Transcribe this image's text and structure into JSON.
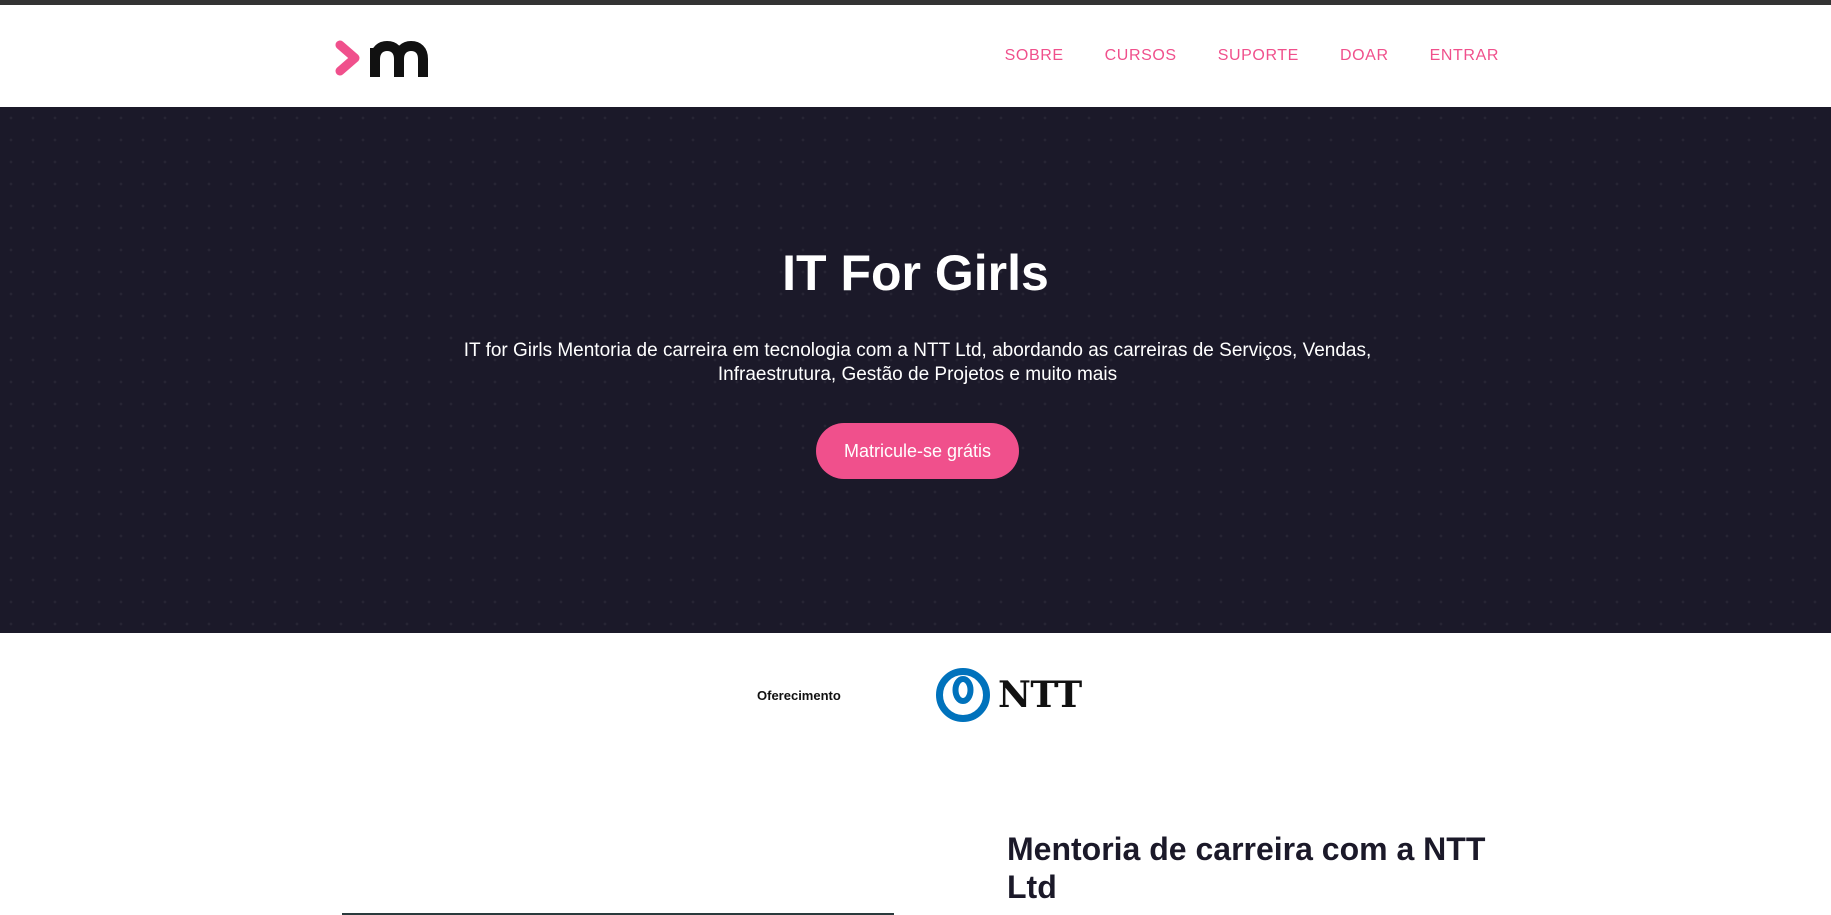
{
  "header": {
    "logo_name": "m-logo",
    "nav": [
      {
        "label": "SOBRE"
      },
      {
        "label": "CURSOS"
      },
      {
        "label": "SUPORTE"
      },
      {
        "label": "DOAR"
      },
      {
        "label": "ENTRAR"
      }
    ]
  },
  "hero": {
    "title": "IT For Girls",
    "subtitle": "IT for Girls Mentoria de carreira em tecnologia com a NTT Ltd, abordando as carreiras de Serviços, Vendas, Infraestrutura, Gestão de Projetos e muito mais",
    "cta_label": "Matricule-se grátis"
  },
  "sponsor": {
    "label": "Oferecimento",
    "logo_text": "NTT"
  },
  "section": {
    "title": "Mentoria de carreira com a NTT Ltd"
  },
  "colors": {
    "accent": "#f0508c",
    "hero_bg": "#1b1929",
    "ntt_blue": "#0072bc"
  }
}
